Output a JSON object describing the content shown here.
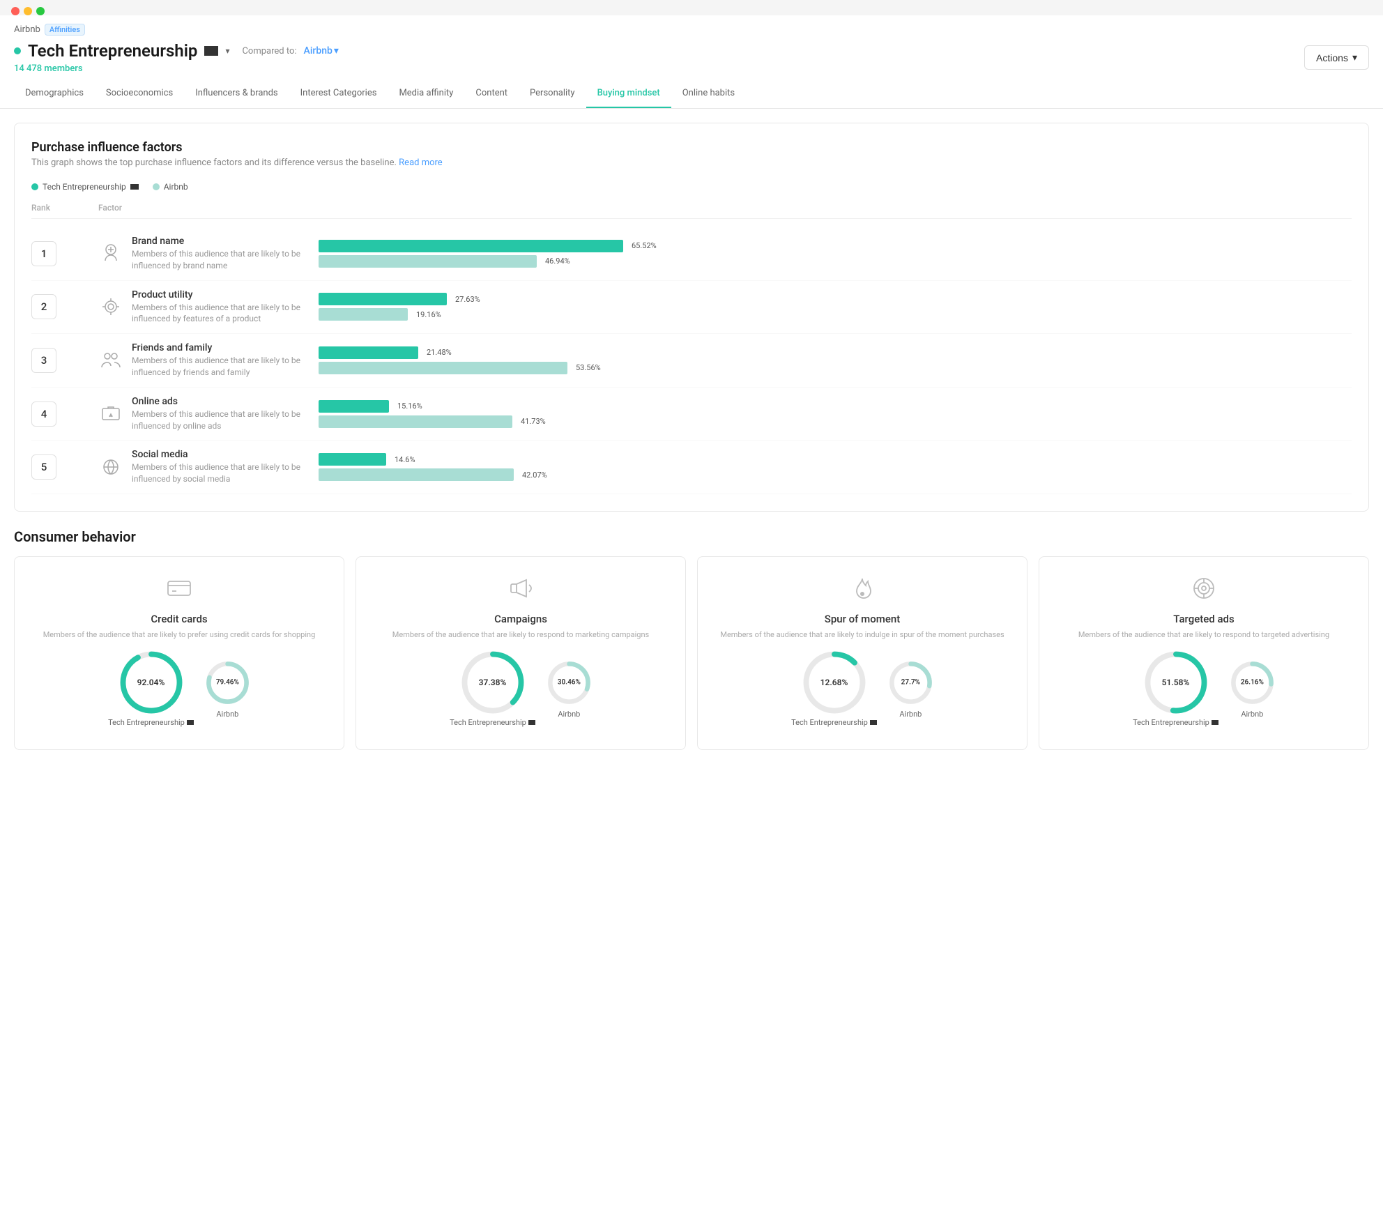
{
  "window": {
    "breadcrumb_parent": "Airbnb",
    "breadcrumb_badge": "Affinities",
    "page_title": "Tech Entrepreneurship",
    "members_count": "14 478 members",
    "compared_to_label": "Compared to:",
    "compared_to_value": "Airbnb",
    "actions_label": "Actions"
  },
  "nav": {
    "tabs": [
      {
        "id": "demographics",
        "label": "Demographics",
        "active": false
      },
      {
        "id": "socioeconomics",
        "label": "Socioeconomics",
        "active": false
      },
      {
        "id": "influencers",
        "label": "Influencers & brands",
        "active": false
      },
      {
        "id": "interest",
        "label": "Interest Categories",
        "active": false
      },
      {
        "id": "media",
        "label": "Media affinity",
        "active": false
      },
      {
        "id": "content",
        "label": "Content",
        "active": false
      },
      {
        "id": "personality",
        "label": "Personality",
        "active": false
      },
      {
        "id": "buying",
        "label": "Buying mindset",
        "active": true
      },
      {
        "id": "online",
        "label": "Online habits",
        "active": false
      }
    ]
  },
  "purchase_section": {
    "title": "Purchase influence factors",
    "description": "This graph shows the top purchase influence factors and its difference versus the baseline.",
    "read_more": "Read more",
    "legend": [
      {
        "label": "Tech Entrepreneurship",
        "color": "teal"
      },
      {
        "label": "Airbnb",
        "color": "light"
      }
    ],
    "columns": [
      "Rank",
      "Factor",
      ""
    ],
    "factors": [
      {
        "rank": "1",
        "name": "Brand name",
        "description": "Members of this audience that are likely to be influenced by brand name",
        "icon": "brand",
        "bars": [
          {
            "value": 65.52,
            "label": "65.52%",
            "maxPct": 75,
            "type": "teal"
          },
          {
            "value": 46.94,
            "label": "46.94%",
            "maxPct": 75,
            "type": "light"
          }
        ]
      },
      {
        "rank": "2",
        "name": "Product utility",
        "description": "Members of this audience that are likely to be influenced by features of a product",
        "icon": "product",
        "bars": [
          {
            "value": 27.63,
            "label": "27.63%",
            "maxPct": 75,
            "type": "teal"
          },
          {
            "value": 19.16,
            "label": "19.16%",
            "maxPct": 75,
            "type": "light"
          }
        ]
      },
      {
        "rank": "3",
        "name": "Friends and family",
        "description": "Members of this audience that are likely to be influenced by friends and family",
        "icon": "friends",
        "bars": [
          {
            "value": 21.48,
            "label": "21.48%",
            "maxPct": 75,
            "type": "teal"
          },
          {
            "value": 53.56,
            "label": "53.56%",
            "maxPct": 75,
            "type": "light"
          }
        ]
      },
      {
        "rank": "4",
        "name": "Online ads",
        "description": "Members of this audience that are likely to be influenced by online ads",
        "icon": "online_ads",
        "bars": [
          {
            "value": 15.16,
            "label": "15.16%",
            "maxPct": 75,
            "type": "teal"
          },
          {
            "value": 41.73,
            "label": "41.73%",
            "maxPct": 75,
            "type": "light"
          }
        ]
      },
      {
        "rank": "5",
        "name": "Social media",
        "description": "Members of this audience that are likely to be influenced by social media",
        "icon": "social",
        "bars": [
          {
            "value": 14.6,
            "label": "14.6%",
            "maxPct": 75,
            "type": "teal"
          },
          {
            "value": 42.07,
            "label": "42.07%",
            "maxPct": 75,
            "type": "light"
          }
        ]
      }
    ]
  },
  "consumer_behavior": {
    "title": "Consumer behavior",
    "cards": [
      {
        "id": "credit_cards",
        "icon": "credit-card",
        "name": "Credit cards",
        "description": "Members of the audience that are likely to prefer using credit cards for shopping",
        "main_pct": "92.04%",
        "main_label": "Tech Entrepreneurship",
        "secondary_pct": "79.46%",
        "secondary_label": "Airbnb",
        "main_color": "#26c6a6",
        "secondary_color": "#a8ddd4"
      },
      {
        "id": "campaigns",
        "icon": "megaphone",
        "name": "Campaigns",
        "description": "Members of the audience that are likely to respond to marketing campaigns",
        "main_pct": "37.38%",
        "main_label": "Tech Entrepreneurship",
        "secondary_pct": "30.46%",
        "secondary_label": "Airbnb",
        "main_color": "#26c6a6",
        "secondary_color": "#a8ddd4"
      },
      {
        "id": "spur_of_moment",
        "icon": "fire",
        "name": "Spur of moment",
        "description": "Members of the audience that are likely to indulge in spur of the moment purchases",
        "main_pct": "12.68%",
        "main_label": "Tech Entrepreneurship",
        "secondary_pct": "27.7%",
        "secondary_label": "Airbnb",
        "main_color": "#26c6a6",
        "secondary_color": "#a8ddd4"
      },
      {
        "id": "targeted_ads",
        "icon": "target",
        "name": "Targeted ads",
        "description": "Members of the audience that are likely to respond to targeted advertising",
        "main_pct": "51.58%",
        "main_label": "Tech Entrepreneurship",
        "secondary_pct": "26.16%",
        "secondary_label": "Airbnb",
        "main_color": "#26c6a6",
        "secondary_color": "#a8ddd4"
      }
    ]
  }
}
